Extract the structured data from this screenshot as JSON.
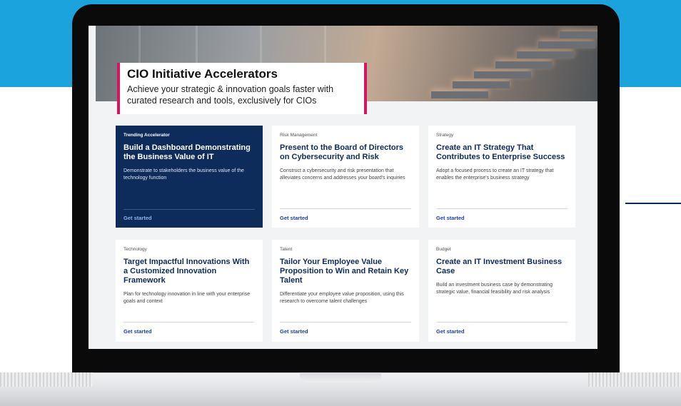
{
  "hero": {
    "title": "CIO Initiative Accelerators",
    "subtitle": "Achieve your strategic & innovation goals faster with curated research and tools, exclusively for CIOs"
  },
  "cards": [
    {
      "category": "Trending Accelerator",
      "title": "Build a Dashboard Demonstrating the Business Value of IT",
      "description": "Demonstrate to stakeholders the business value of the technology function",
      "cta": "Get started"
    },
    {
      "category": "Risk Management",
      "title": "Present to the Board of Directors on Cybersecurity and Risk",
      "description": "Construct a cybersecurity and risk presentation that alleviates concerns and addresses your board's inquiries",
      "cta": "Get started"
    },
    {
      "category": "Strategy",
      "title": "Create an IT Strategy That Contributes to Enterprise Success",
      "description": "Adopt a focused process to create an IT strategy that enables the enterprise's business strategy",
      "cta": "Get started"
    },
    {
      "category": "Technology",
      "title": "Target Impactful Innovations With a Customized Innovation Framework",
      "description": "Plan for technology innovation in line with your enterprise goals and context",
      "cta": "Get started"
    },
    {
      "category": "Talent",
      "title": "Tailor Your Employee Value Proposition to Win and Retain Key Talent",
      "description": "Differentiate your employee value proposition, using this research to overcome talent challenges",
      "cta": "Get started"
    },
    {
      "category": "Budget",
      "title": "Create an IT Investment Business Case",
      "description": "Build an investment business case by demonstrating strategic value, financial feasibility and risk analysis",
      "cta": "Get started"
    }
  ],
  "colors": {
    "background_band": "#1aa3dc",
    "accent": "#d6145f",
    "navy": "#0d2b5b",
    "link": "#1a3fae"
  }
}
